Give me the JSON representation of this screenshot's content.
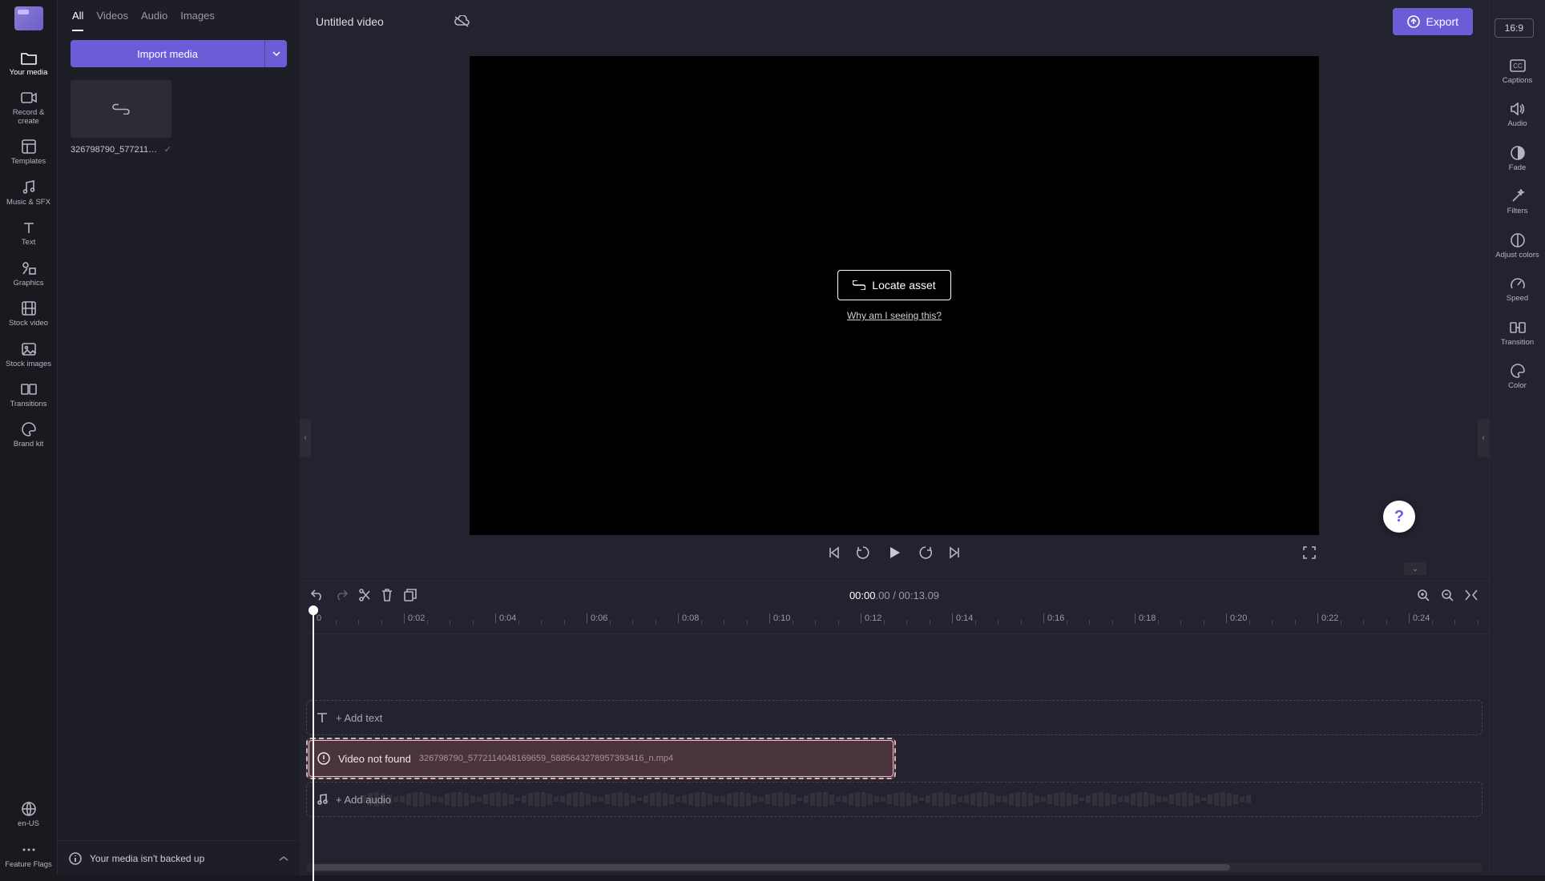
{
  "leftNav": {
    "items": [
      {
        "label": "Your media"
      },
      {
        "label": "Record & create"
      },
      {
        "label": "Templates"
      },
      {
        "label": "Music & SFX"
      },
      {
        "label": "Text"
      },
      {
        "label": "Graphics"
      },
      {
        "label": "Stock video"
      },
      {
        "label": "Stock images"
      },
      {
        "label": "Transitions"
      },
      {
        "label": "Brand kit"
      }
    ],
    "locale": "en-US",
    "featureFlags": "Feature Flags"
  },
  "mediaPanel": {
    "tabs": [
      "All",
      "Videos",
      "Audio",
      "Images"
    ],
    "importLabel": "Import media",
    "assetName": "326798790_5772114…",
    "backupMessage": "Your media isn't backed up"
  },
  "header": {
    "title": "Untitled video",
    "exportLabel": "Export",
    "aspect": "16:9"
  },
  "rightNav": {
    "items": [
      {
        "label": "Captions"
      },
      {
        "label": "Audio"
      },
      {
        "label": "Fade"
      },
      {
        "label": "Filters"
      },
      {
        "label": "Adjust colors"
      },
      {
        "label": "Speed"
      },
      {
        "label": "Transition"
      },
      {
        "label": "Color"
      }
    ]
  },
  "stage": {
    "locateLabel": "Locate asset",
    "whyLink": "Why am I seeing this?"
  },
  "timeline": {
    "currentTime": "00:00",
    "currentSub": ".00",
    "sep": " / ",
    "totalTime": "00:13",
    "totalSub": ".09",
    "ruler": [
      "0",
      "0:02",
      "0:04",
      "0:06",
      "0:08",
      "0:10",
      "0:12",
      "0:14",
      "0:16",
      "0:18",
      "0:20",
      "0:22",
      "0:24"
    ],
    "addText": "+ Add text",
    "videoNotFound": "Video not found",
    "videoFile": "326798790_5772114048169659_5885643278957393416_n.mp4",
    "addAudio": "+ Add audio"
  },
  "help": "?"
}
